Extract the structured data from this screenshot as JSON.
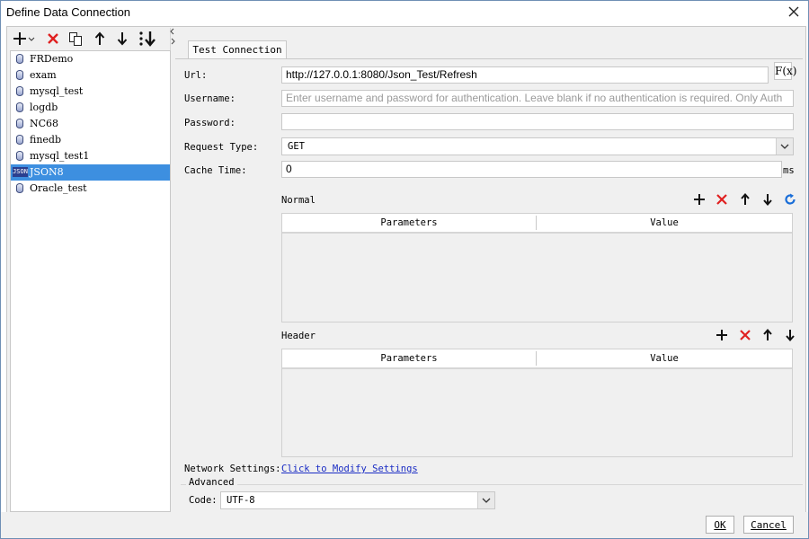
{
  "window": {
    "title": "Define Data Connection"
  },
  "connections": [
    {
      "label": "FRDemo",
      "icon": "database-icon"
    },
    {
      "label": "exam",
      "icon": "database-icon"
    },
    {
      "label": "mysql_test",
      "icon": "database-icon"
    },
    {
      "label": "logdb",
      "icon": "database-icon"
    },
    {
      "label": "NC68",
      "icon": "database-icon"
    },
    {
      "label": "finedb",
      "icon": "database-icon"
    },
    {
      "label": "mysql_test1",
      "icon": "database-icon"
    },
    {
      "label": "JSON8",
      "icon": "json-icon",
      "selected": true
    },
    {
      "label": "Oracle_test",
      "icon": "database-icon"
    }
  ],
  "json_icon_text": "JSON",
  "tab": {
    "label": "Test Connection"
  },
  "form": {
    "url_label": "Url:",
    "url_value": "http://127.0.0.1:8080/Json_Test/Refresh",
    "fx_label": "F(x)",
    "username_label": "Username:",
    "username_placeholder": "Enter username and password for authentication. Leave blank if no authentication is required. Only Auth",
    "password_label": "Password:",
    "request_type_label": "Request Type:",
    "request_type_value": "GET",
    "cache_time_label": "Cache Time:",
    "cache_time_value": "0",
    "cache_unit": "ms"
  },
  "normal": {
    "title": "Normal",
    "columns": [
      "Parameters",
      "Value"
    ]
  },
  "header": {
    "title": "Header",
    "columns": [
      "Parameters",
      "Value"
    ]
  },
  "network": {
    "label": "Network Settings:",
    "link": "Click to Modify Settings"
  },
  "advanced": {
    "label": "Advanced",
    "code_label": "Code:",
    "code_value": "UTF-8"
  },
  "buttons": {
    "ok": "OK",
    "cancel": "Cancel"
  },
  "colors": {
    "selection": "#3d8fe0",
    "delete_red": "#e02020",
    "refresh_blue": "#1a6ed8",
    "link": "#1a2cc4"
  }
}
